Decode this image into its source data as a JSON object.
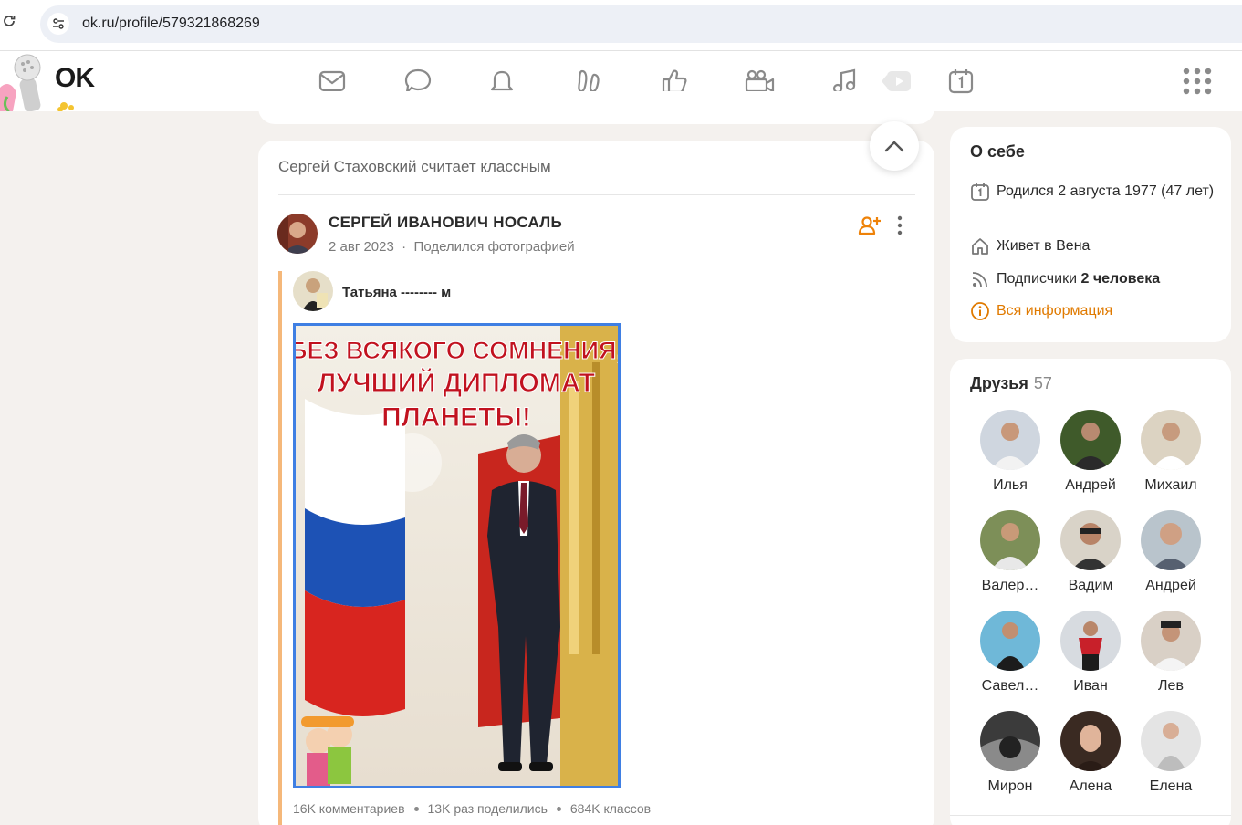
{
  "browser": {
    "url": "ok.ru/profile/579321868269"
  },
  "header": {
    "logo_text": "OK",
    "nav": [
      "messages-icon",
      "discussions-icon",
      "notifications-icon",
      "guests-icon",
      "likes-icon",
      "video-icon",
      "music-icon",
      "video-play-icon",
      "calendar-icon"
    ]
  },
  "feed": {
    "heading": "Сергей Стаховский считает классным",
    "author": "СЕРГЕЙ ИВАНОВИЧ НОСАЛЬ",
    "date": "2 авг 2023",
    "action": "Поделился фотографией",
    "reshared_author": "Татьяна -------- м",
    "photo_caption": [
      "БЕЗ ВСЯКОГО СОМНЕНИЯ,",
      "ЛУЧШИЙ ДИПЛОМАТ",
      "ПЛАНЕТЫ!"
    ],
    "stats": {
      "comments": "16K комментариев",
      "shares": "13K раз поделились",
      "likes": "684K классов"
    }
  },
  "about": {
    "title": "О себе",
    "birth": "Родился 2 августа 1977 (47 лет)",
    "lives": "Живет в Вена",
    "followers_prefix": "Подписчики",
    "followers_count": "2 человека",
    "all_info": "Вся информация"
  },
  "friends": {
    "title": "Друзья",
    "count": "57",
    "items": [
      {
        "name": "Илья"
      },
      {
        "name": "Андрей"
      },
      {
        "name": "Михаил"
      },
      {
        "name": "Валер…"
      },
      {
        "name": "Вадим"
      },
      {
        "name": "Андрей"
      },
      {
        "name": "Савел…"
      },
      {
        "name": "Иван"
      },
      {
        "name": "Лев"
      },
      {
        "name": "Мирон"
      },
      {
        "name": "Алена"
      },
      {
        "name": "Елена"
      }
    ]
  }
}
